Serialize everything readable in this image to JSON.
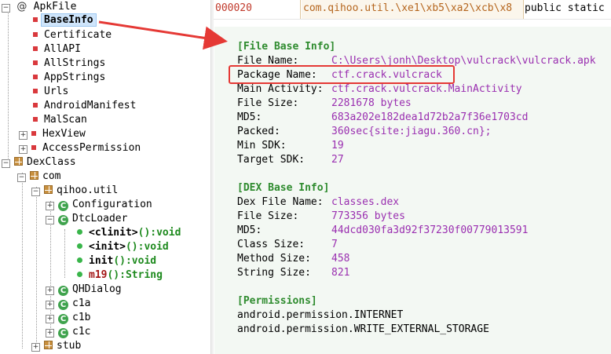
{
  "tree": {
    "apkfile": "ApkFile",
    "apk_children": [
      "BaseInfo",
      "Certificate",
      "AllAPI",
      "AllStrings",
      "AppStrings",
      "Urls",
      "AndroidManifest",
      "MalScan",
      "HexView",
      "AccessPermission"
    ],
    "dexclass": "DexClass",
    "com": "com",
    "qihoo_util": "qihoo.util",
    "configuration": "Configuration",
    "dtcloader": "DtcLoader",
    "methods": [
      {
        "name": "<clinit>",
        "sig": "():void"
      },
      {
        "name": "<init>",
        "sig": "():void"
      },
      {
        "name": "init",
        "sig": "():void"
      },
      {
        "name": "m19",
        "sig": "():String"
      }
    ],
    "qhdialog": "QHDialog",
    "c1a": "c1a",
    "c1b": "c1b",
    "c1c": "c1c",
    "stub": "stub"
  },
  "hexbar": {
    "address": "000020",
    "data": "com.qihoo.util.\\xe1\\xb5\\xa2\\xcb\\x8",
    "decl": "public static"
  },
  "file_info": {
    "header": "[File Base Info]",
    "rows": [
      {
        "k": "File Name:",
        "v": "C:\\Users\\jonh\\Desktop\\vulcrack\\vulcrack.apk"
      },
      {
        "k": "Package Name:",
        "v": "ctf.crack.vulcrack"
      },
      {
        "k": "Main Activity:",
        "v": "ctf.crack.vulcrack.MainActivity"
      },
      {
        "k": "File Size:",
        "v": "2281678 bytes"
      },
      {
        "k": "MD5:",
        "v": "683a202e182dea1d72b2a7f36e1703cd"
      },
      {
        "k": "Packed:",
        "v": "360sec{site:jiagu.360.cn};"
      },
      {
        "k": "Min SDK:",
        "v": "19"
      },
      {
        "k": "Target SDK:",
        "v": "27"
      }
    ]
  },
  "dex_info": {
    "header": "[DEX Base Info]",
    "rows": [
      {
        "k": "Dex File Name:",
        "v": "classes.dex"
      },
      {
        "k": "File Size:",
        "v": "773356 bytes"
      },
      {
        "k": "MD5:",
        "v": "44dcd030fa3d92f37230f00779013591"
      },
      {
        "k": "Class Size:",
        "v": "7"
      },
      {
        "k": "Method Size:",
        "v": "458"
      },
      {
        "k": "String Size:",
        "v": "821"
      }
    ]
  },
  "permissions": {
    "header": "[Permissions]",
    "items": [
      "android.permission.INTERNET",
      "android.permission.WRITE_EXTERNAL_STORAGE"
    ]
  },
  "colors": {
    "highlight_box": "#e53935",
    "arrow": "#e53935",
    "section_header": "#2e8b2e",
    "value_text": "#9a2fb0"
  }
}
